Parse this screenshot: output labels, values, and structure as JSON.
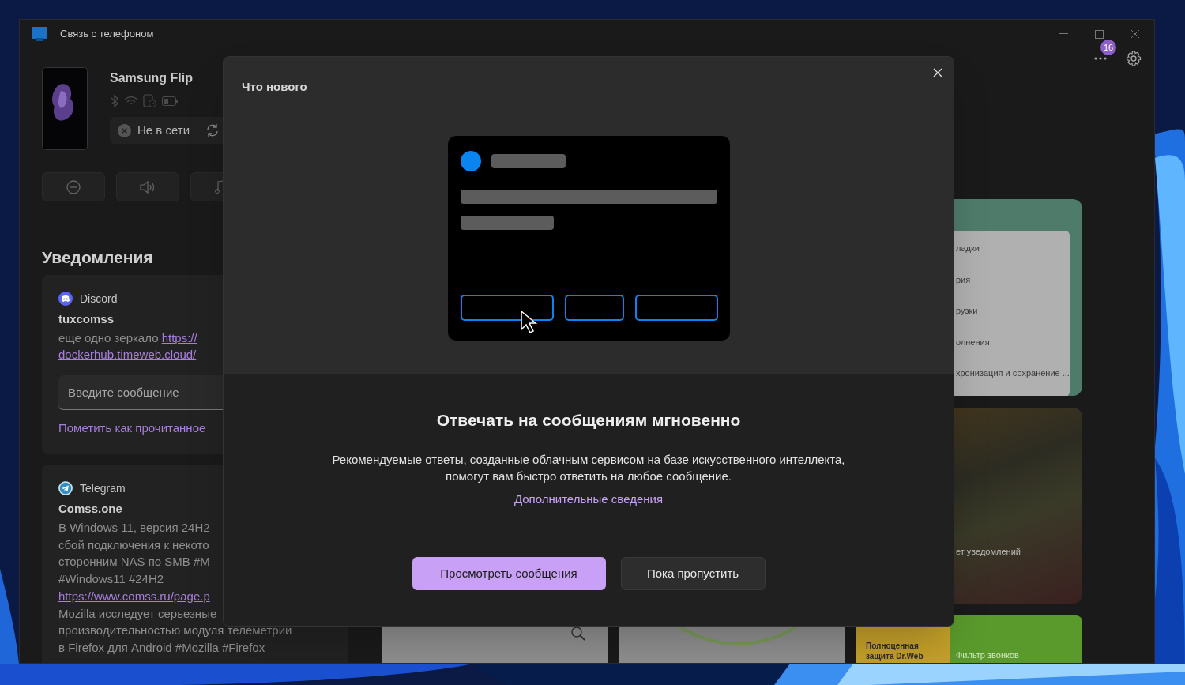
{
  "window": {
    "title": "Связь с телефоном"
  },
  "phone": {
    "name": "Samsung Flip",
    "status": "Не в сети"
  },
  "header": {
    "badge": "16"
  },
  "notifications": {
    "title": "Уведомления",
    "items": [
      {
        "kind": "discord",
        "app": "Discord",
        "sender": "tuxcomss",
        "text": "еще одно зеркало",
        "link_lines": [
          "https://",
          "dockerhub.timeweb.cloud/"
        ],
        "reply_placeholder": "Введите сообщение",
        "action": "Пометить как прочитанное"
      },
      {
        "kind": "telegram",
        "app": "Telegram",
        "sender": "Comss.one",
        "lines": [
          {
            "text": "В Windows 11, версия 24H2",
            "link": false
          },
          {
            "text": "сбой подключения к некото",
            "link": false
          },
          {
            "text": "сторонним NAS по SMB  #M",
            "link": false
          },
          {
            "text": "#Windows11 #24H2",
            "link": false
          },
          {
            "text": "https://www.comss.ru/page.p",
            "link": true
          },
          {
            "text": "Mozilla исследует серьезные",
            "link": false
          },
          {
            "text": "производительностью модуля телеметрии",
            "link": false
          },
          {
            "text": "в Firefox для Android  #Mozilla #Firefox",
            "link": false
          }
        ]
      }
    ]
  },
  "cards": {
    "settings_menu": [
      "ладки",
      "рия",
      "рузки",
      "олнения",
      "хронизация и сохранение ..."
    ],
    "empty_state": "ет уведомлений",
    "promo": [
      "Полноценная защита Dr.Web",
      "Фильтр звонков"
    ]
  },
  "dialog": {
    "title": "Что нового",
    "heading": "Отвечать на сообщениям мгновенно",
    "body_lines": [
      "Рекомендуемые ответы, созданные облачным сервисом на базе искусственного интеллекта,",
      "помогут вам быстро ответить на любое сообщение."
    ],
    "link": "Дополнительные сведения",
    "buttons": [
      {
        "label": "Просмотреть сообщения",
        "kind": "primary"
      },
      {
        "label": "Пока пропустить",
        "kind": "secondary"
      }
    ]
  }
}
